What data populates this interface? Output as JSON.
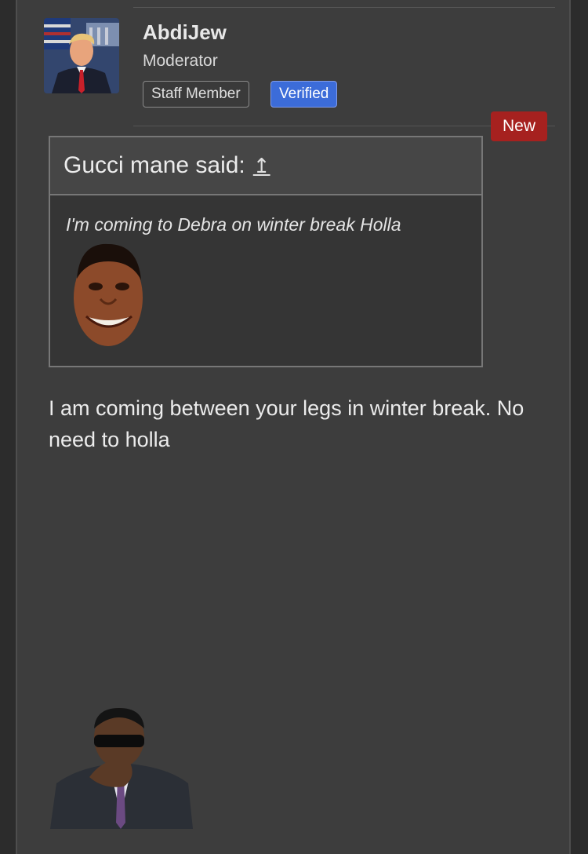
{
  "post": {
    "author": {
      "username": "AbdiJew",
      "title": "Moderator",
      "badges": [
        "Staff Member",
        "Verified"
      ]
    },
    "new_label": "New",
    "quote": {
      "header": "Gucci mane said:",
      "arrow": "↥",
      "text": "I'm coming to Debra on winter break Holla",
      "emoji": "grinning-face-sticker"
    },
    "body": "I am coming between your legs in winter break. No need to holla",
    "bottom_emoji": "laughing-man-sticker"
  },
  "colors": {
    "panel_bg": "#3d3d3d",
    "verified_bg": "#3c6cd9",
    "new_badge_bg": "#a6211f",
    "quote_header_bg": "#464646"
  }
}
